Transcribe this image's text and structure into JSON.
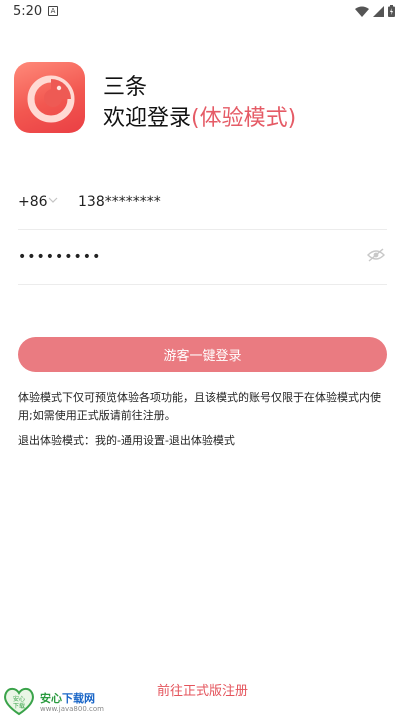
{
  "status_bar": {
    "time": "5:20",
    "notification_icon": "A"
  },
  "app": {
    "name": "三条",
    "welcome": "欢迎登录",
    "mode_tag": "(体验模式)"
  },
  "phone": {
    "country_code": "+86",
    "value": "138********"
  },
  "password": {
    "value": "•••••••••"
  },
  "login_button": "游客一键登录",
  "notice": "体验模式下仅可预览体验各项功能，且该模式的账号仅限于在体验模式内使用;如需使用正式版请前往注册。",
  "exit_notice": "退出体验模式：我的-通用设置-退出体验模式",
  "register_link": "前往正式版注册",
  "watermark": {
    "heart_text": "安心\n下载",
    "title_green": "安心",
    "title_blue": "下载网",
    "url": "www.java800.com"
  },
  "colors": {
    "accent": "#ea7b81",
    "accent_text": "#e55b66",
    "link": "#e4545c"
  },
  "icons": [
    "wifi-icon",
    "signal-icon",
    "battery-icon",
    "chevron-down-icon",
    "eye-off-icon"
  ]
}
